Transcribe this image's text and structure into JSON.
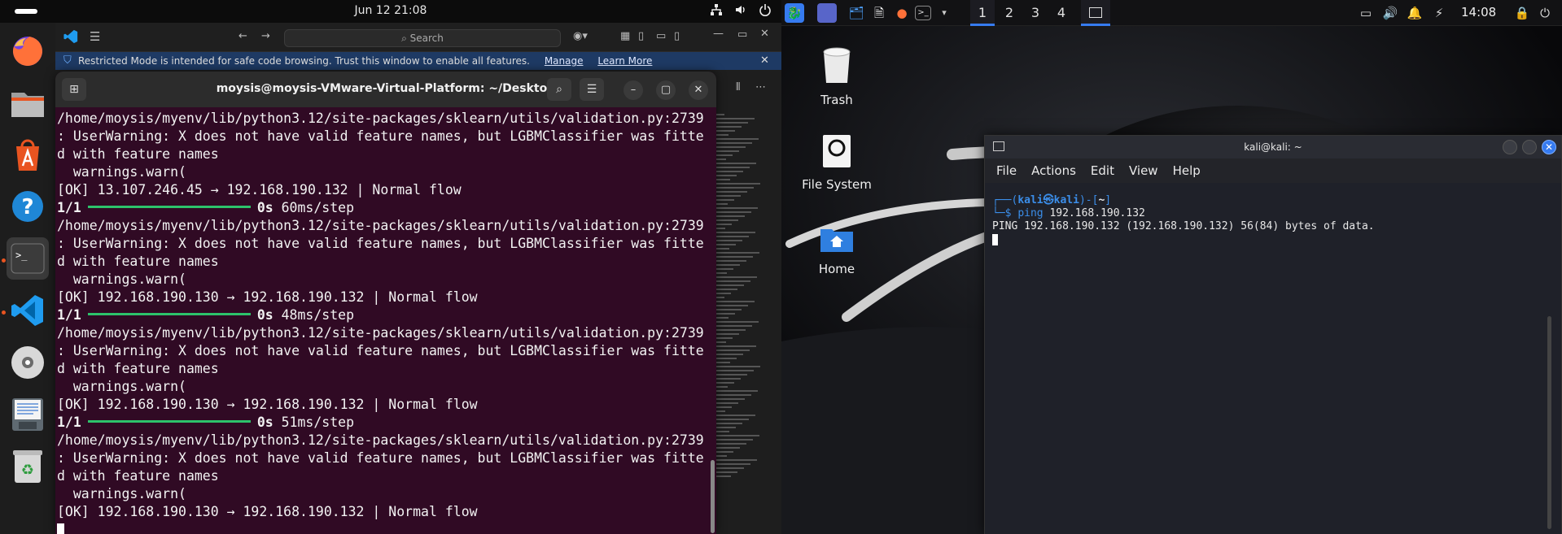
{
  "ubuntu": {
    "topbar": {
      "clock": "Jun 12  21:08"
    },
    "dock": {
      "items": [
        "firefox",
        "files",
        "app-center",
        "help",
        "terminal",
        "vscode",
        "disc",
        "text-editor",
        "trash"
      ]
    },
    "vscode": {
      "search_placeholder": "Search",
      "banner_text": "Restricted Mode is intended for safe code browsing. Trust this window to enable all features.",
      "banner_manage": "Manage",
      "banner_learn_more": "Learn More"
    },
    "terminal": {
      "title": "moysis@moysis-VMware-Virtual-Platform: ~/Desktop",
      "lines": [
        {
          "text": "/home/moysis/myenv/lib/python3.12/site-packages/sklearn/utils/validation.py:2739"
        },
        {
          "text": ": UserWarning: X does not have valid feature names, but LGBMClassifier was fitte"
        },
        {
          "text": "d with feature names"
        },
        {
          "text": "  warnings.warn("
        },
        {
          "text": "[OK] 13.107.246.45 → 192.168.190.132 | Normal flow"
        },
        {
          "progress_label": "1/1",
          "progress_time": "0s",
          "progress_step": "60ms/step"
        },
        {
          "text": "/home/moysis/myenv/lib/python3.12/site-packages/sklearn/utils/validation.py:2739"
        },
        {
          "text": ": UserWarning: X does not have valid feature names, but LGBMClassifier was fitte"
        },
        {
          "text": "d with feature names"
        },
        {
          "text": "  warnings.warn("
        },
        {
          "text": "[OK] 192.168.190.130 → 192.168.190.132 | Normal flow"
        },
        {
          "progress_label": "1/1",
          "progress_time": "0s",
          "progress_step": "48ms/step"
        },
        {
          "text": "/home/moysis/myenv/lib/python3.12/site-packages/sklearn/utils/validation.py:2739"
        },
        {
          "text": ": UserWarning: X does not have valid feature names, but LGBMClassifier was fitte"
        },
        {
          "text": "d with feature names"
        },
        {
          "text": "  warnings.warn("
        },
        {
          "text": "[OK] 192.168.190.130 → 192.168.190.132 | Normal flow"
        },
        {
          "progress_label": "1/1",
          "progress_time": "0s",
          "progress_step": "51ms/step"
        },
        {
          "text": "/home/moysis/myenv/lib/python3.12/site-packages/sklearn/utils/validation.py:2739"
        },
        {
          "text": ": UserWarning: X does not have valid feature names, but LGBMClassifier was fitte"
        },
        {
          "text": "d with feature names"
        },
        {
          "text": "  warnings.warn("
        },
        {
          "text": "[OK] 192.168.190.130 → 192.168.190.132 | Normal flow"
        }
      ]
    }
  },
  "kali": {
    "panel": {
      "workspaces": [
        "1",
        "2",
        "3",
        "4"
      ],
      "clock": "14:08"
    },
    "desktop_icons": {
      "trash": "Trash",
      "filesystem": "File System",
      "home": "Home"
    },
    "terminal": {
      "title": "kali@kali: ~",
      "menu": [
        "File",
        "Actions",
        "Edit",
        "View",
        "Help"
      ],
      "prompt_user": "kali",
      "prompt_at": "㉿",
      "prompt_host": "kali",
      "prompt_dir": "~",
      "command": "ping",
      "command_arg": "192.168.190.132",
      "output": "PING 192.168.190.132 (192.168.190.132) 56(84) bytes of data."
    }
  },
  "colors": {
    "ubuntu_terminal_bg": "#300a24",
    "ubuntu_accent": "#e95420",
    "progress_green": "#2dc26b",
    "kali_accent": "#367bf0",
    "kali_prompt_blue": "#3b8eea"
  }
}
